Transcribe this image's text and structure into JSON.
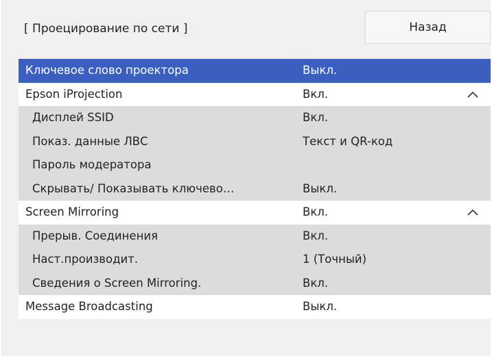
{
  "header": {
    "title": "[ Проецирование по сети ]",
    "back_label": "Назад"
  },
  "menu": [
    {
      "label": "Ключевое слово проектора",
      "value": "Выкл."
    },
    {
      "label": "Epson iProjection",
      "value": "Вкл.",
      "icon": "chevron-up-icon"
    },
    {
      "label": "Дисплей SSID",
      "value": "Вкл."
    },
    {
      "label": "Показ. данные ЛВС",
      "value": "Текст и QR-код"
    },
    {
      "label": "Пароль модератора",
      "value": ""
    },
    {
      "label": "Скрывать/ Показывать ключево…",
      "value": "Выкл."
    },
    {
      "label": "Screen Mirroring",
      "value": "Вкл.",
      "icon": "chevron-up-icon"
    },
    {
      "label": "Прерыв. Соединения",
      "value": "Вкл."
    },
    {
      "label": "Наст.производит.",
      "value": "1 (Точный)"
    },
    {
      "label": "Сведения о Screen Mirroring.",
      "value": "Вкл."
    },
    {
      "label": "Message Broadcasting",
      "value": "Выкл."
    }
  ],
  "colors": {
    "selected_row": "#3a5fbf",
    "sub_row": "#dcdcdc",
    "background": "#f0f0f0"
  }
}
